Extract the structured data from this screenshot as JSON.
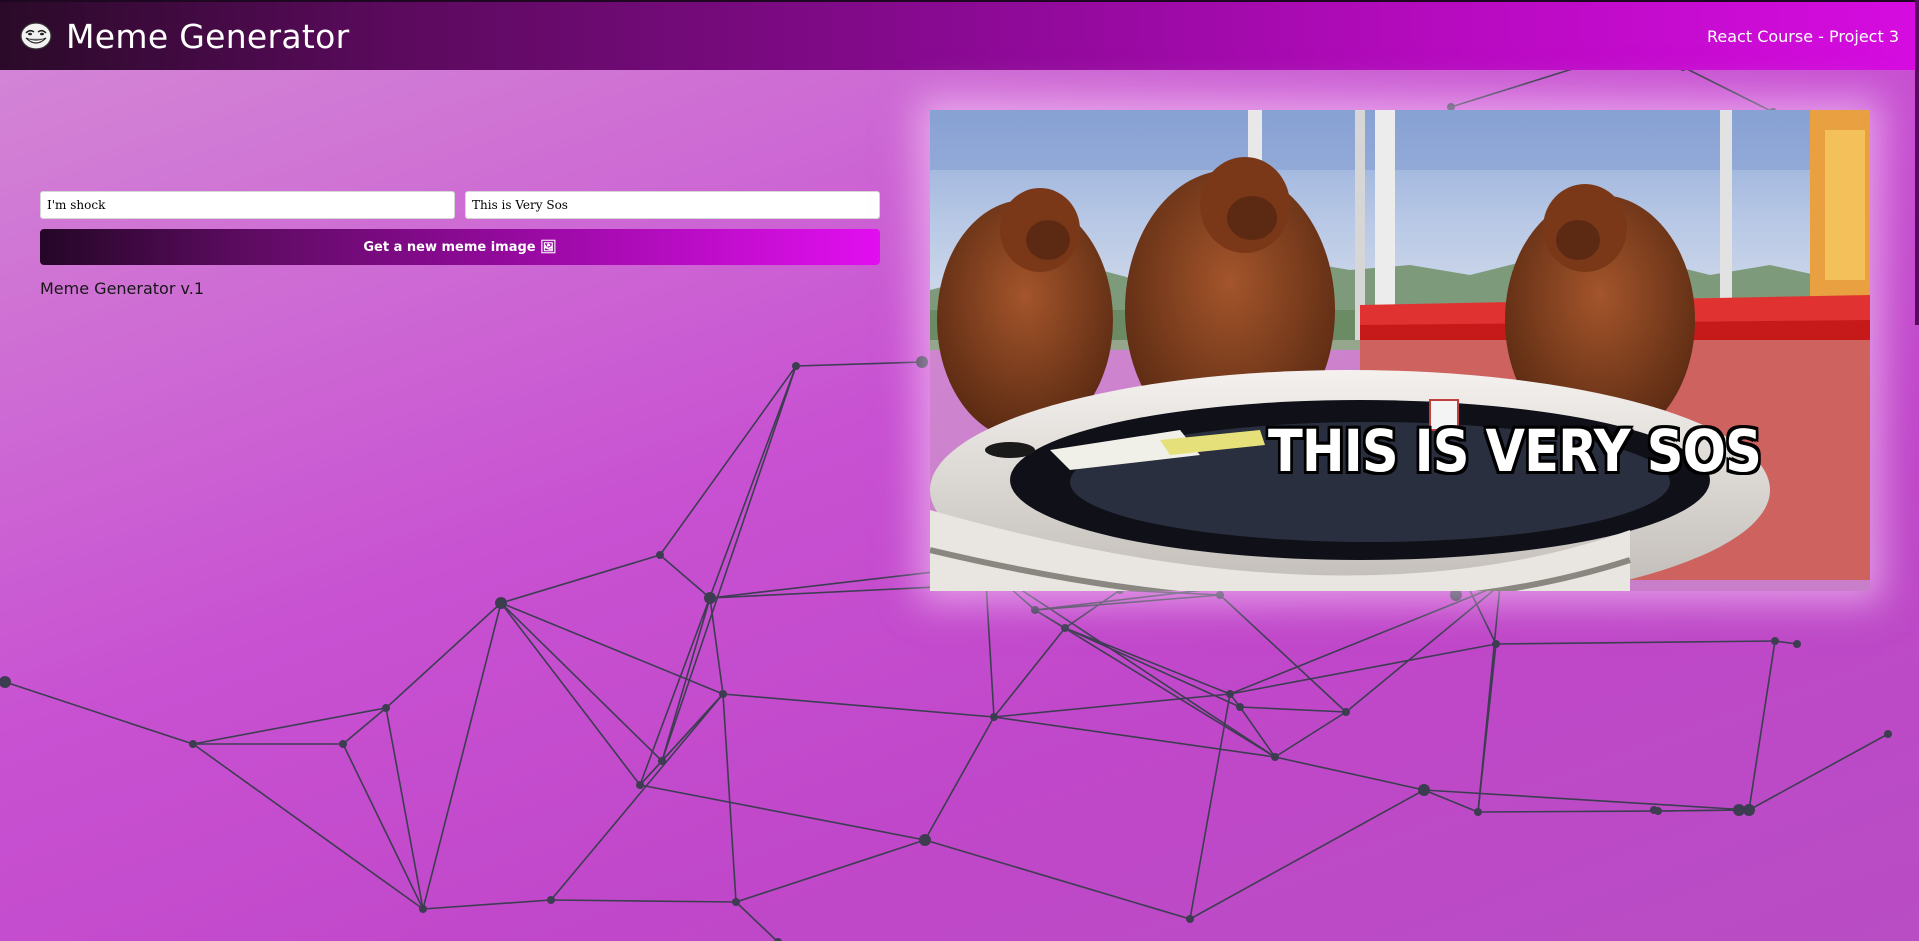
{
  "navbar": {
    "logo_icon": "trollface-icon",
    "title": "Meme Generator",
    "project": "React Course - Project 3"
  },
  "form": {
    "top_text": {
      "value": "I'm shock",
      "placeholder": ""
    },
    "bottom_text": {
      "value": "This is Very Sos",
      "placeholder": ""
    },
    "button_label": "Get a new meme image 🖼",
    "version": "Meme Generator v.1"
  },
  "meme": {
    "top_caption": "",
    "bottom_caption": "THIS IS VERY SOS",
    "image_icon": "three-orangutans-meme-image"
  },
  "colors": {
    "accent_start": "#240626",
    "accent_end": "#e20ff0",
    "background": "#c851d2",
    "network_line": "#3d3d52"
  }
}
